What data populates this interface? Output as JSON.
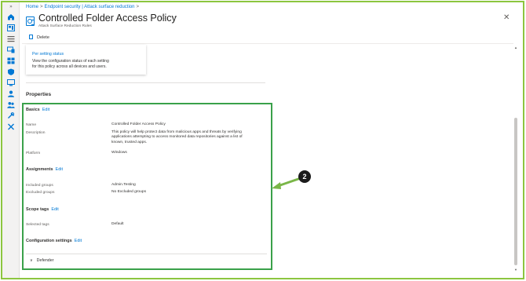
{
  "breadcrumb": {
    "items": [
      "Home",
      "Endpoint security | Attack surface reduction"
    ],
    "separator": ">"
  },
  "header": {
    "title": "Controlled Folder Access Policy",
    "subtitle": "Attack Surface Reduction Rules",
    "pin_icon": "pin-icon",
    "more_label": "...",
    "close_icon": "close-icon"
  },
  "toolbar": {
    "delete_label": "Delete"
  },
  "per_setting_card": {
    "title": "Per setting status",
    "description_line1": "View the configuration status of each setting",
    "description_line2": "for this policy across all devices and users."
  },
  "properties": {
    "title": "Properties",
    "edit_label": "Edit",
    "basics": {
      "title": "Basics",
      "name_label": "Name",
      "name_value": "Controlled Folder Access Policy",
      "description_label": "Description",
      "description_lines": [
        "This policy will help protect data from malicious apps and threats by verifying",
        "applications attempting to access monitored data repositories against a list of",
        "known, trusted apps."
      ],
      "platform_label": "Platform",
      "platform_value": "Windows"
    },
    "assignments": {
      "title": "Assignments",
      "included_label": "Included groups",
      "included_value": "Admin.Testing",
      "excluded_label": "Excluded groups",
      "excluded_value": "No Excluded groups"
    },
    "scope_tags": {
      "title": "Scope tags",
      "selected_label": "Selected tags",
      "selected_value": "Default"
    },
    "configuration": {
      "title": "Configuration settings",
      "defender_label": "Defender"
    }
  },
  "annotation": {
    "marker": "2",
    "highlight_color": "#3aa14a",
    "arrow_color": "#7ab648"
  },
  "colors": {
    "accent": "#0078d4",
    "frame": "#8cc63f"
  }
}
